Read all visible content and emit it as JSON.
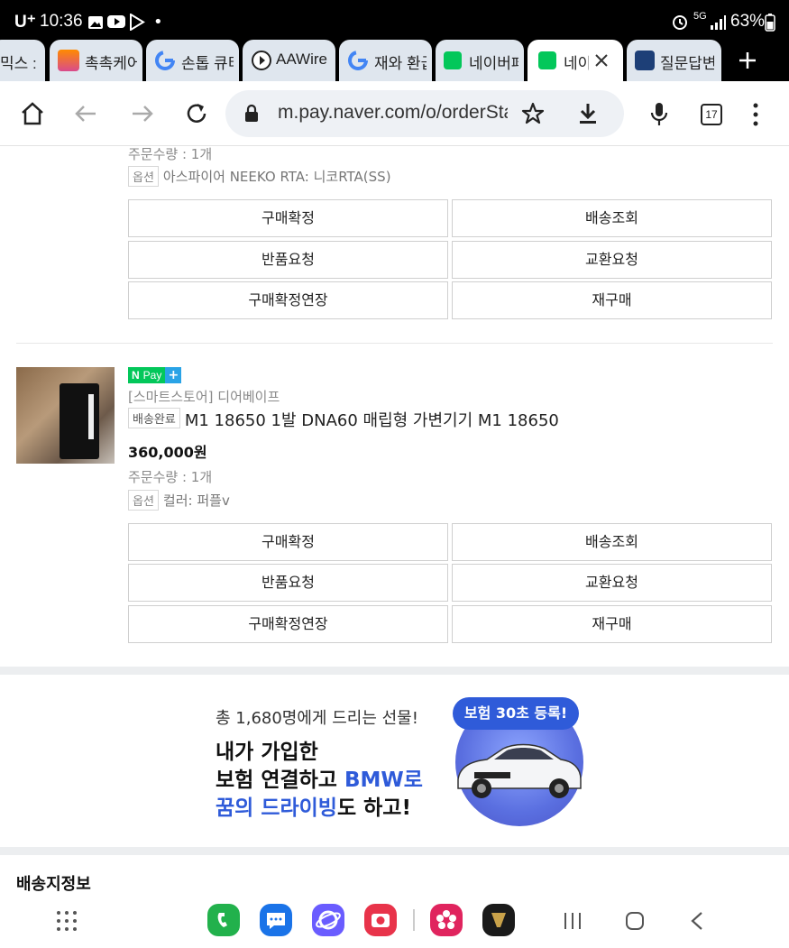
{
  "status_bar": {
    "carrier": "U⁺",
    "time": "10:36",
    "network": "5G",
    "battery": "63%"
  },
  "tabs": [
    {
      "label": "믹스 :",
      "icon": "partial-tab"
    },
    {
      "label": "촉촉케어",
      "icon": "app-favicon"
    },
    {
      "label": "손톱 큐티",
      "icon": "google-icon"
    },
    {
      "label": "AAWire",
      "icon": "play-icon"
    },
    {
      "label": "재와 환급",
      "icon": "google-icon"
    },
    {
      "label": "네이버페",
      "icon": "npay-icon"
    },
    {
      "label": "네이",
      "icon": "npay-icon",
      "active": true
    },
    {
      "label": "질문답변",
      "icon": "cafe-icon"
    }
  ],
  "address_bar": {
    "url": "m.pay.naver.com/o/orderSta",
    "tab_count": "17"
  },
  "order1": {
    "quantity": "주문수량 : 1개",
    "option_badge": "옵션",
    "option": "아스파이어 NEEKO RTA: 니코RTA(SS)",
    "buttons": {
      "confirm": "구매확정",
      "tracking": "배송조회",
      "return": "반품요청",
      "exchange": "교환요청",
      "extend": "구매확정연장",
      "rebuy": "재구매"
    }
  },
  "order2": {
    "npay_label": "Pay",
    "store": "[스마트스토어] 디어베이프",
    "status_badge": "배송완료",
    "title": "M1 18650 1발 DNA60 매립형 가변기기 M1 18650",
    "price": "360,000원",
    "quantity": "주문수량 : 1개",
    "option_badge": "옵션",
    "option": "컬러: 퍼플v",
    "buttons": {
      "confirm": "구매확정",
      "tracking": "배송조회",
      "return": "반품요청",
      "exchange": "교환요청",
      "extend": "구매확정연장",
      "rebuy": "재구매"
    }
  },
  "banner": {
    "line1": "총 1,680명에게 드리는 선물!",
    "line2": "내가 가입한",
    "line3a": "보험 연결하고 ",
    "line3b": "BMW로",
    "line4a": "꿈의 드라이빙",
    "line4b": "도 하고!",
    "pill": "보험 30초 등록!",
    "accent": "#2f5bd9"
  },
  "section_title": "배송지정보",
  "colors": {
    "naver_green": "#03c75a",
    "npay_plus_blue": "#2aa3e6"
  }
}
